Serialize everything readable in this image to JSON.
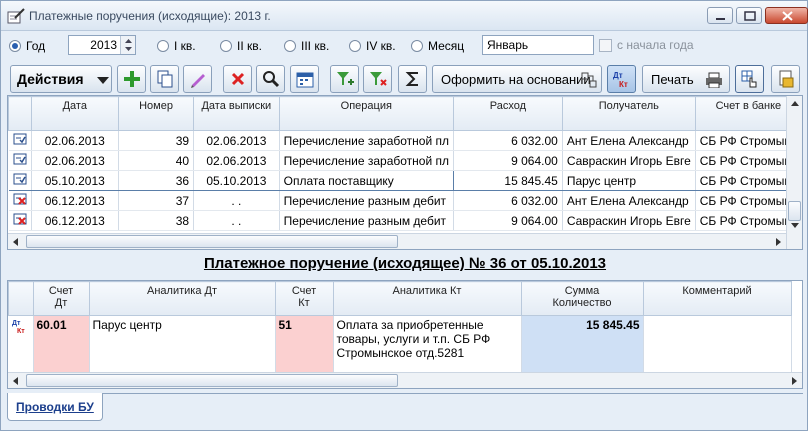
{
  "window": {
    "title": "Платежные поручения (исходящие): 2013 г.",
    "icons": {
      "app": "pen-document-icon",
      "minimize": "minimize-icon",
      "maximize": "maximize-icon",
      "close": "close-icon"
    }
  },
  "period": {
    "year_label": "Год",
    "year_value": "2013",
    "quarters": [
      "I кв.",
      "II кв.",
      "III кв.",
      "IV кв."
    ],
    "month_label": "Месяц",
    "month_value": "Январь",
    "since_start_label": "с начала года",
    "selected": "year"
  },
  "toolbar": {
    "actions_label": "Действия",
    "create_basis_label": "Оформить на основании",
    "print_label": "Печать",
    "icons": [
      "add-icon",
      "copy-icon",
      "edit-icon",
      "delete-icon",
      "search-icon",
      "calendar-icon",
      "filter-add-icon",
      "filter-remove-icon",
      "sum-icon",
      "create-basis-icon",
      "debit-credit-icon",
      "printer-icon",
      "edit-grid-icon",
      "export-icon"
    ]
  },
  "grid": {
    "columns": [
      "",
      "Дата",
      "Номер",
      "Дата выписки",
      "Операция",
      "Расход",
      "Получатель",
      "Счет в банке"
    ],
    "rows": [
      {
        "status": "posted",
        "date": "02.06.2013",
        "number": "39",
        "issue_date": "02.06.2013",
        "operation": "Перечисление заработной пл",
        "amount": "6 032.00",
        "recipient": "Ант Елена Александр",
        "account": "СБ РФ Стромынс"
      },
      {
        "status": "posted",
        "date": "02.06.2013",
        "number": "40",
        "issue_date": "02.06.2013",
        "operation": "Перечисление заработной пл",
        "amount": "9 064.00",
        "recipient": "Савраскин Игорь Евге",
        "account": "СБ РФ Стромынс"
      },
      {
        "status": "posted",
        "date": "05.10.2013",
        "number": "36",
        "issue_date": "05.10.2013",
        "operation": "Оплата поставщику",
        "amount": "15 845.45",
        "recipient": "Парус центр",
        "account": "СБ РФ Стромынс"
      },
      {
        "status": "unposted",
        "date": "06.12.2013",
        "number": "37",
        "issue_date": " .  .",
        "operation": "Перечисление разным дебит",
        "amount": "6 032.00",
        "recipient": "Ант Елена Александр",
        "account": "СБ РФ Стромынс"
      },
      {
        "status": "unposted",
        "date": "06.12.2013",
        "number": "38",
        "issue_date": " .  .",
        "operation": "Перечисление разным дебит",
        "amount": "9 064.00",
        "recipient": "Савраскин Игорь Евге",
        "account": "СБ РФ Стромынс"
      }
    ],
    "selected_row": 2
  },
  "document_title": "Платежное поручение (исходящее) № 36 от 05.10.2013",
  "entries": {
    "columns": [
      "",
      "Счет Дт",
      "Аналитика Дт",
      "Счет Кт",
      "Аналитика Кт",
      "Сумма Количество",
      "Комментарий"
    ],
    "rows": [
      {
        "debit_account": "60.01",
        "debit_analytics": "Парус центр",
        "credit_account": "51",
        "credit_analytics": "Оплата за приобретенные товары, услуги и т.п. СБ РФ Стромынское отд.5281",
        "sum": "15 845.45",
        "comment": ""
      }
    ]
  },
  "tabs": [
    "Проводки БУ"
  ]
}
